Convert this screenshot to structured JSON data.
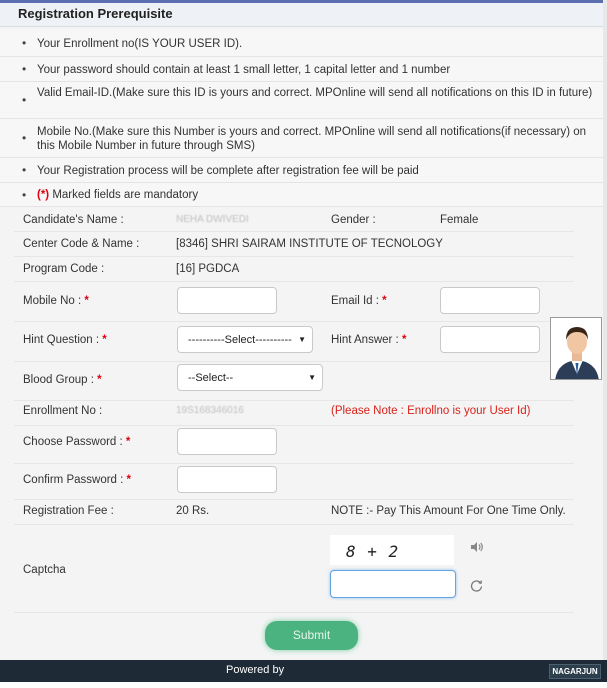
{
  "header": {
    "title": "Registration Prerequisite"
  },
  "prerequisites": [
    {
      "text": "Your Enrollment no(IS YOUR  USER ID)."
    },
    {
      "text": "Your password should contain at least 1 small letter, 1 capital letter and 1 number"
    },
    {
      "text": "Valid Email-ID.(Make sure this ID is yours and correct. MPOnline will send all notifications on this ID in future)"
    },
    {
      "text": "Mobile No.(Make sure this Number is yours and correct. MPOnline will send all notifications(if necessary) on this Mobile Number in future through SMS)"
    },
    {
      "text": "Your Registration process will be complete after registration fee will be paid"
    },
    {
      "mark": "(*)",
      "text": " Marked fields are mandatory"
    }
  ],
  "required_mark": "*",
  "form": {
    "candidate_name_label": "Candidate's Name :",
    "candidate_name_value": "NEHA DWIVEDI",
    "gender_label": "Gender :",
    "gender_value": "Female",
    "center_label": "Center Code & Name :",
    "center_value": "[8346] SHRI SAIRAM INSTITUTE OF TECNOLOGY",
    "program_label": "Program Code :",
    "program_value": "[16] PGDCA",
    "mobile_label": "Mobile No : ",
    "mobile_value": "",
    "email_label": "Email Id : ",
    "email_value": "",
    "hint_q_label": "Hint Question : ",
    "hint_q_value": "----------Select----------",
    "hint_a_label": "Hint Answer : ",
    "hint_a_value": "",
    "blood_label": "Blood Group : ",
    "blood_value": "--Select--",
    "enroll_label": "Enrollment No :",
    "enroll_value": "19S168346016",
    "enroll_note": "(Please Note : Enrollno is your User Id)",
    "choose_pwd_label": "Choose Password : ",
    "confirm_pwd_label": "Confirm Password : ",
    "fee_label": "Registration Fee :",
    "fee_value": "20 Rs.",
    "fee_note": "NOTE :- Pay This Amount For One Time Only.",
    "captcha_label": "Captcha",
    "captcha_text": "8 + 2",
    "captcha_input_value": ""
  },
  "actions": {
    "submit_label": "Submit"
  },
  "footer": {
    "powered_label": "Powered by",
    "brand_label": "NAGARJUN"
  },
  "colors": {
    "required": "#e3000f",
    "submit": "#4bb37f",
    "footer": "#1e2a35",
    "note": "#d9221c"
  }
}
